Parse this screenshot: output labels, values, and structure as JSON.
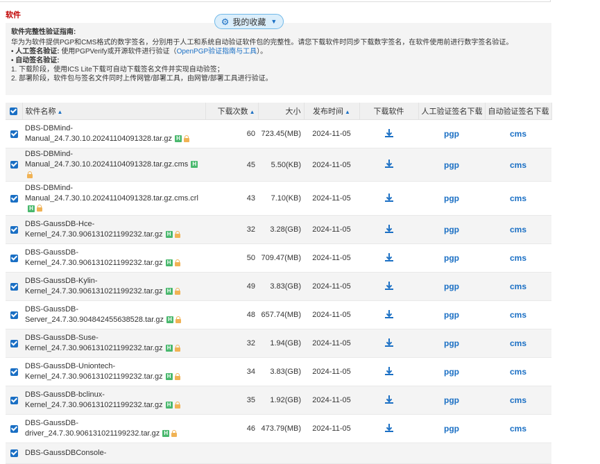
{
  "section_title": "软件",
  "favorites_button": "我的收藏",
  "guide": {
    "title": "软件完整性验证指南:",
    "line1": "华为为软件提供PGP和CMS格式的数字签名，分别用于人工和系统自动验证软件包的完整性。请您下载软件时同步下载数字签名，在软件使用前进行数字签名验证。",
    "manual_label": "人工签名验证:",
    "manual_text": "使用PGPVerify或开源软件进行验证（",
    "manual_link": "OpenPGP验证指南与工具",
    "manual_end": "）。",
    "auto_label": "自动签名验证:",
    "step1": "1. 下载阶段，使用ICS Lite下载可自动下载签名文件并实现自动验签；",
    "step2": "2. 部署阶段，软件包与签名文件同时上传网管/部署工具，由网管/部署工具进行验证。"
  },
  "table": {
    "headers": {
      "name": "软件名称",
      "downloads": "下载次数",
      "size": "大小",
      "date": "发布时间",
      "download": "下载软件",
      "manual_sig": "人工验证签名下载",
      "auto_sig": "自动验证签名下载"
    },
    "rows": [
      {
        "name_lines": [
          "DBS-DBMind-",
          "Manual_24.7.30.10.20241104091328.tar.gz"
        ],
        "downloads": "60",
        "size": "723.45(MB)",
        "date": "2024-11-05",
        "pgp": "pgp",
        "cms": "cms"
      },
      {
        "name_lines": [
          "DBS-DBMind-",
          "Manual_24.7.30.10.20241104091328.tar.gz.cms"
        ],
        "downloads": "45",
        "size": "5.50(KB)",
        "date": "2024-11-05",
        "pgp": "pgp",
        "cms": "cms"
      },
      {
        "name_lines": [
          "DBS-DBMind-",
          "Manual_24.7.30.10.20241104091328.tar.gz.cms.crl"
        ],
        "downloads": "43",
        "size": "7.10(KB)",
        "date": "2024-11-05",
        "pgp": "pgp",
        "cms": "cms"
      },
      {
        "name_lines": [
          "DBS-GaussDB-Hce-",
          "Kernel_24.7.30.906131021199232.tar.gz"
        ],
        "downloads": "32",
        "size": "3.28(GB)",
        "date": "2024-11-05",
        "pgp": "pgp",
        "cms": "cms"
      },
      {
        "name_lines": [
          "DBS-GaussDB-",
          "Kernel_24.7.30.906131021199232.tar.gz"
        ],
        "downloads": "50",
        "size": "709.47(MB)",
        "date": "2024-11-05",
        "pgp": "pgp",
        "cms": "cms"
      },
      {
        "name_lines": [
          "DBS-GaussDB-Kylin-",
          "Kernel_24.7.30.906131021199232.tar.gz"
        ],
        "downloads": "49",
        "size": "3.83(GB)",
        "date": "2024-11-05",
        "pgp": "pgp",
        "cms": "cms"
      },
      {
        "name_lines": [
          "DBS-GaussDB-",
          "Server_24.7.30.904842455638528.tar.gz"
        ],
        "downloads": "48",
        "size": "657.74(MB)",
        "date": "2024-11-05",
        "pgp": "pgp",
        "cms": "cms"
      },
      {
        "name_lines": [
          "DBS-GaussDB-Suse-",
          "Kernel_24.7.30.906131021199232.tar.gz"
        ],
        "downloads": "32",
        "size": "1.94(GB)",
        "date": "2024-11-05",
        "pgp": "pgp",
        "cms": "cms"
      },
      {
        "name_lines": [
          "DBS-GaussDB-Uniontech-",
          "Kernel_24.7.30.906131021199232.tar.gz"
        ],
        "downloads": "34",
        "size": "3.83(GB)",
        "date": "2024-11-05",
        "pgp": "pgp",
        "cms": "cms"
      },
      {
        "name_lines": [
          "DBS-GaussDB-bclinux-",
          "Kernel_24.7.30.906131021199232.tar.gz"
        ],
        "downloads": "35",
        "size": "1.92(GB)",
        "date": "2024-11-05",
        "pgp": "pgp",
        "cms": "cms"
      },
      {
        "name_lines": [
          "DBS-GaussDB-",
          "driver_24.7.30.906131021199232.tar.gz"
        ],
        "downloads": "46",
        "size": "473.79(MB)",
        "date": "2024-11-05",
        "pgp": "pgp",
        "cms": "cms"
      },
      {
        "name_lines": [
          "DBS-GaussDBConsole-",
          ""
        ],
        "downloads": "",
        "size": "",
        "date": "",
        "pgp": "",
        "cms": ""
      }
    ]
  },
  "colors": {
    "accent": "#1a6fc4",
    "section_title": "#c00000",
    "badge_h": "#49b86d",
    "badge_lock": "#f0b254"
  }
}
